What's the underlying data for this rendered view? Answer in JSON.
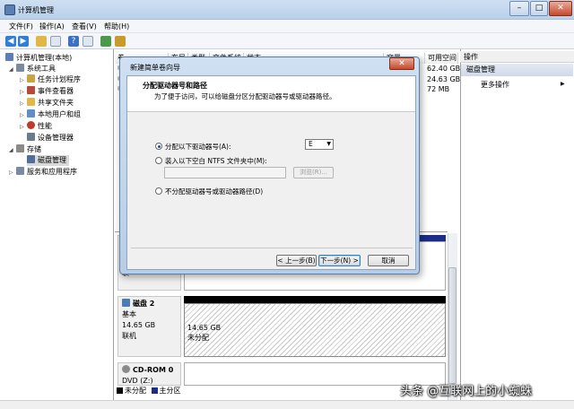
{
  "window": {
    "title": "计算机管理",
    "min": "–",
    "max": "□",
    "close": "✕"
  },
  "menu": [
    "文件(F)",
    "操作(A)",
    "查看(V)",
    "帮助(H)"
  ],
  "tree": {
    "root": "计算机管理(本地)",
    "system_tools": "系统工具",
    "task_scheduler": "任务计划程序",
    "event_viewer": "事件查看器",
    "shared_folders": "共享文件夹",
    "local_users": "本地用户和组",
    "performance": "性能",
    "device_manager": "设备管理器",
    "storage": "存储",
    "disk_management": "磁盘管理",
    "services_apps": "服务和应用程序"
  },
  "columns": [
    "卷",
    "布局",
    "类型",
    "文件系统",
    "状态",
    "容量",
    "可用空间"
  ],
  "free_space": [
    "62.40 GB",
    "24.63 GB",
    "72 MB"
  ],
  "actions": {
    "header": "操作",
    "selected": "磁盘管理",
    "more": "更多操作"
  },
  "disks": {
    "disk2": {
      "name": "磁盘 2",
      "type": "基本",
      "size": "14.65 GB",
      "status": "联机",
      "part_size": "14.65 GB",
      "part_state": "未分配"
    },
    "cdrom": {
      "name": "CD-ROM 0",
      "line2": "DVD (Z:)"
    },
    "partial_labels": [
      "基",
      "9",
      "联"
    ]
  },
  "legend": {
    "unallocated": "未分配",
    "primary": "主分区"
  },
  "wizard": {
    "title": "新建简单卷向导",
    "heading": "分配驱动器号和路径",
    "subheading": "为了便于访问，可以给磁盘分区分配驱动器号或驱动器路径。",
    "opt_letter": "分配以下驱动器号(A):",
    "drive_letter": "E",
    "opt_folder": "装入以下空白 NTFS 文件夹中(M):",
    "browse": "浏览(R)...",
    "opt_none": "不分配驱动器号或驱动器路径(D)",
    "back": "< 上一步(B)",
    "next": "下一步(N) >",
    "cancel": "取消"
  },
  "watermark": "头条 @互联网上的小蜘蛛",
  "colors": {
    "primary_partition": "#1a2d8c",
    "title_bar": "#b9d1ea",
    "selection": "#cfd9e8"
  }
}
